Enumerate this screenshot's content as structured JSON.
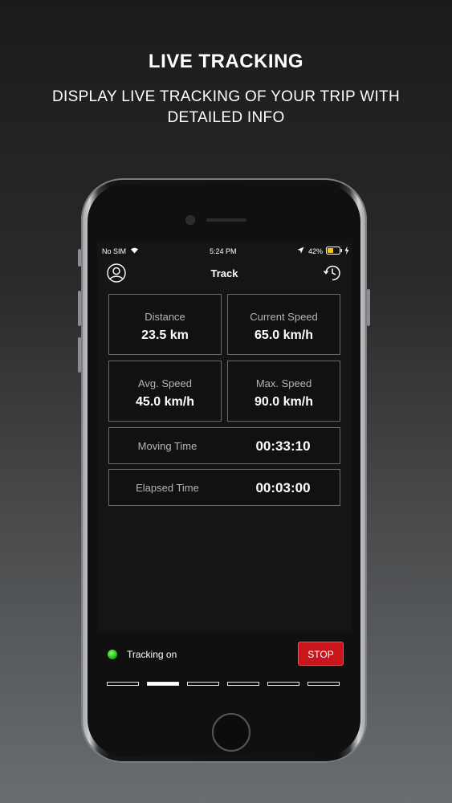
{
  "hero": {
    "title": "LIVE TRACKING",
    "subtitle": "DISPLAY LIVE TRACKING OF YOUR TRIP WITH DETAILED INFO"
  },
  "status_bar": {
    "carrier": "No SIM",
    "time": "5:24 PM",
    "battery": "42%"
  },
  "nav": {
    "title": "Track",
    "left_icon": "profile-icon",
    "right_icon": "history-clock-icon"
  },
  "stats": {
    "distance": {
      "label": "Distance",
      "value": "23.5 km"
    },
    "current_speed": {
      "label": "Current Speed",
      "value": "65.0 km/h"
    },
    "avg_speed": {
      "label": "Avg. Speed",
      "value": "45.0 km/h"
    },
    "max_speed": {
      "label": "Max. Speed",
      "value": "90.0 km/h"
    },
    "moving_time": {
      "label": "Moving Time",
      "value": "00:33:10"
    },
    "elapsed_time": {
      "label": "Elapsed Time",
      "value": "00:03:00"
    }
  },
  "tracking": {
    "status_label": "Tracking on",
    "status_color": "#22b51b",
    "stop_label": "STOP",
    "stop_color": "#c9151b"
  },
  "page_indicator": {
    "count": 6,
    "active_index": 1
  }
}
